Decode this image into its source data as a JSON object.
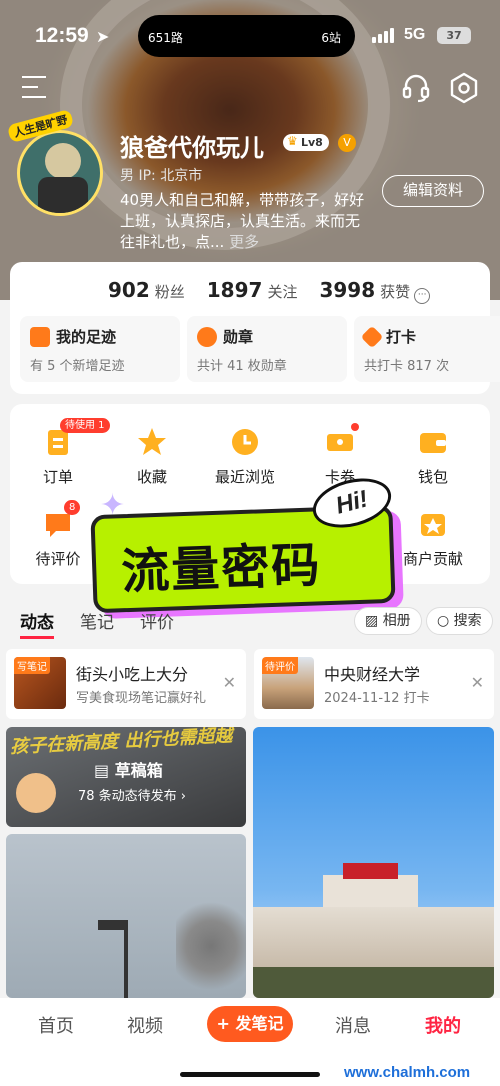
{
  "status_bar": {
    "time": "12:59",
    "island_left": "651路",
    "island_right": "6站",
    "network": "5G",
    "battery": "37"
  },
  "header": {
    "menu_icon": "menu-icon",
    "service_icon": "headset-icon",
    "settings_icon": "gear-icon"
  },
  "profile": {
    "avatar_tag": "人生是旷野",
    "name": "狼爸代你玩儿",
    "level": "Lv8",
    "gender_ip": "男  IP: 北京市",
    "bio": "40男人和自己和解，带带孩子，好好上班，认真探店，认真生活。来而无往非礼也，点...",
    "more": "更多",
    "edit_button": "编辑资料"
  },
  "stats": [
    {
      "value": "902",
      "label": "粉丝"
    },
    {
      "value": "1897",
      "label": "关注"
    },
    {
      "value": "3998",
      "label": "获赞"
    }
  ],
  "tiles": [
    {
      "title": "我的足迹",
      "sub": "有 5 个新增足迹"
    },
    {
      "title": "勋章",
      "sub": "共计 41 枚勋章"
    },
    {
      "title": "打卡",
      "sub": "共打卡 817 次"
    }
  ],
  "features": {
    "orders": "订单",
    "orders_badge": "待使用 1",
    "favorites": "收藏",
    "recent": "最近浏览",
    "coupons": "卡券",
    "wallet": "钱包",
    "pending_review": "待评价",
    "pending_badge": "8",
    "merchant": "商户贡献"
  },
  "watermark": {
    "text": "流量密码",
    "hi": "Hi!"
  },
  "tabs": [
    "动态",
    "笔记",
    "评价"
  ],
  "pills": {
    "album": "相册",
    "search": "搜索"
  },
  "cards": [
    {
      "tag": "写笔记",
      "title": "街头小吃上大分",
      "sub": "写美食现场笔记赢好礼"
    },
    {
      "tag": "待评价",
      "title": "中央财经大学",
      "sub": "2024-11-12 打卡"
    }
  ],
  "draft": {
    "overlay_text": "孩子在新高度 出行也需超越",
    "label": "草稿箱",
    "sub": "78 条动态待发布 ›"
  },
  "bottom_nav": {
    "home": "首页",
    "video": "视频",
    "post": "+ 发笔记",
    "messages": "消息",
    "mine": "我的",
    "watermark": "www.chalmh.com"
  },
  "colors": {
    "accent": "#ff2442",
    "orange": "#ff5a1f"
  }
}
